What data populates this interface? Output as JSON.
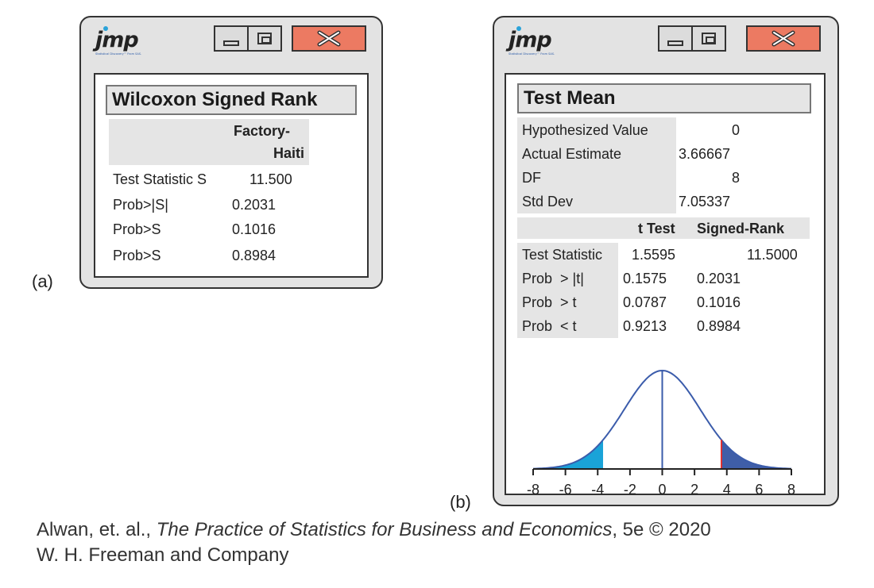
{
  "panel_a": {
    "logo": "jmp",
    "logo_tagline": "Statistical Discovery™ From SAS.",
    "title": "Wilcoxon Signed Rank",
    "column_header_line1": "Factory-",
    "column_header_line2": "Haiti",
    "rows": [
      {
        "label": "Test Statistic S",
        "value": "11.500"
      },
      {
        "label": "Prob>|S|",
        "value": "0.2031"
      },
      {
        "label": "Prob>S",
        "value": "0.1016"
      },
      {
        "label": "Prob>S",
        "value": "0.8984"
      }
    ],
    "panel_label": "(a)"
  },
  "panel_b": {
    "logo": "jmp",
    "logo_tagline": "Statistical Discovery™ From SAS.",
    "title": "Test Mean",
    "summary": [
      {
        "label": "Hypothesized Value",
        "value": "0"
      },
      {
        "label": "Actual Estimate",
        "value": "3.66667"
      },
      {
        "label": "DF",
        "value": "8"
      },
      {
        "label": "Std Dev",
        "value": "7.05337"
      }
    ],
    "test_headers": [
      "t Test",
      "Signed-Rank"
    ],
    "tests": [
      {
        "label": "Test Statistic",
        "t": "1.5595",
        "sr": "11.5000"
      },
      {
        "label": "Prob  > |t|",
        "t": "0.1575",
        "sr": "0.2031"
      },
      {
        "label": "Prob  > t",
        "t": "0.0787",
        "sr": "0.1016"
      },
      {
        "label": "Prob  < t",
        "t": "0.9213",
        "sr": "0.8984"
      }
    ],
    "axis_ticks": [
      "-8",
      "-6",
      "-4",
      "-2",
      "0",
      "2",
      "4",
      "6",
      "8"
    ],
    "panel_label": "(b)"
  },
  "caption": {
    "line1_prefix": "Alwan, et. al., ",
    "line1_title": "The Practice of Statistics for Business and Economics",
    "line1_suffix": ", 5e © 2020",
    "line2": "W. H. Freeman and Company"
  },
  "colors": {
    "window_bg": "#e3e3e3",
    "close_button": "#ec7a62",
    "curve": "#3b5cab",
    "left_tail": "#1aa3d8",
    "right_tail": "#3f5ea8",
    "test_statistic_line": "#e03030"
  }
}
